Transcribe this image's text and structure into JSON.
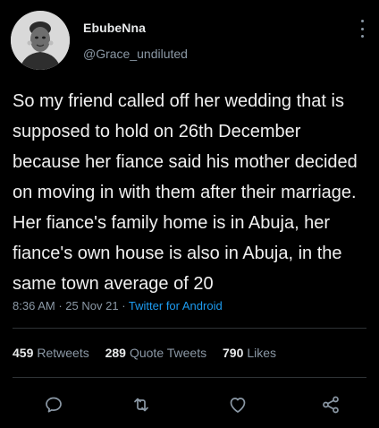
{
  "user": {
    "display_name": "EbubeNna",
    "handle": "@Grace_undiluted"
  },
  "tweet": {
    "text": "So my friend called off her wedding that is supposed to hold on 26th December because her fiance said his  mother decided on moving in with them after their marriage. Her fiance's family home is in Abuja, her fiance's own house is also in Abuja, in the same town average of 20",
    "time": "8:36 AM",
    "date": "25 Nov 21",
    "separator": "·",
    "source": "Twitter for Android"
  },
  "stats": {
    "retweets_count": "459",
    "retweets_label": "Retweets",
    "quotes_count": "289",
    "quotes_label": "Quote Tweets",
    "likes_count": "790",
    "likes_label": "Likes"
  },
  "icons": {
    "more": "more-vertical-icon",
    "reply": "reply-icon",
    "retweet": "retweet-icon",
    "like": "heart-icon",
    "share": "share-icon"
  },
  "colors": {
    "background": "#000000",
    "text": "#e7e9ea",
    "secondary": "#8b98a5",
    "link": "#1d9bf0",
    "divider": "#2f3336"
  }
}
